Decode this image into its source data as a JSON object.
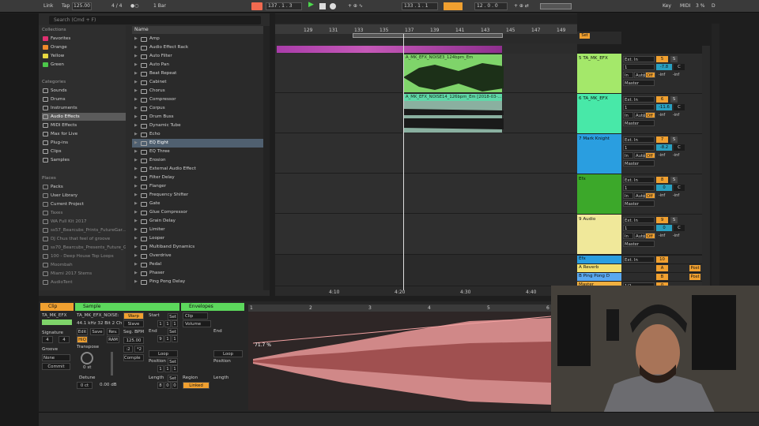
{
  "topbar": {
    "link": "Link",
    "tap": "Tap",
    "tempo": "125.00",
    "meter": "4 / 4",
    "quant": "1 Bar",
    "pos": "137 .  1 .  3",
    "loop_start": "133 .  1 .  1",
    "loop_len": "12 .  0 .  0",
    "key": "Key",
    "midi": "MIDI",
    "cpu": "3 %",
    "d": "D"
  },
  "browser": {
    "search_placeholder": "Search (Cmd + F)",
    "collections_label": "Collections",
    "collections": [
      {
        "label": "Favorites",
        "color": "#e03070"
      },
      {
        "label": "Orange",
        "color": "#f08a2a"
      },
      {
        "label": "Yellow",
        "color": "#e8d840"
      },
      {
        "label": "Green",
        "color": "#4cc84a"
      }
    ],
    "categories_label": "Categories",
    "categories": [
      "Sounds",
      "Drums",
      "Instruments",
      "Audio Effects",
      "MIDI Effects",
      "Max for Live",
      "Plug-ins",
      "Clips",
      "Samples"
    ],
    "selected_category": "Audio Effects",
    "places_label": "Places",
    "places": [
      "Packs",
      "User Library",
      "Current Project",
      "Taxes",
      "WA Full Kit 2017",
      "ss57_Bearcubs_Prints_FutureGar...",
      "DJ Chus that feel of groove",
      "ss70_Bearcubs_Presents_Future_G...",
      "100 - Deep House Top Loops",
      "Moombah",
      "Miami 2017 Stems",
      "AudioTent"
    ],
    "dim_places": [
      "Taxes",
      "WA Full Kit 2017",
      "ss57_Bearcubs_Prints_FutureGar...",
      "DJ Chus that feel of groove",
      "ss70_Bearcubs_Presents_Future_G...",
      "100 - Deep House Top Loops",
      "Moombah",
      "Miami 2017 Stems",
      "AudioTent"
    ],
    "name_header": "Name",
    "files": [
      "Amp",
      "Audio Effect Rack",
      "Auto Filter",
      "Auto Pan",
      "Beat Repeat",
      "Cabinet",
      "Chorus",
      "Compressor",
      "Corpus",
      "Drum Buss",
      "Dynamic Tube",
      "Echo",
      "EQ Eight",
      "EQ Three",
      "Erosion",
      "External Audio Effect",
      "Filter Delay",
      "Flanger",
      "Frequency Shifter",
      "Gate",
      "Glue Compressor",
      "Grain Delay",
      "Limiter",
      "Looper",
      "Multiband Dynamics",
      "Overdrive",
      "Pedal",
      "Phaser",
      "Ping Pong Delay"
    ],
    "selected_file": "EQ Eight"
  },
  "arrangement": {
    "bars": [
      "129",
      "131",
      "133",
      "135",
      "137",
      "139",
      "141",
      "143",
      "145",
      "147",
      "149"
    ],
    "times": [
      "4:10",
      "4:20",
      "4:30",
      "4:40"
    ],
    "clips": [
      {
        "name": "A_MK_EFX_NOISE3_124bpm_Em",
        "color": "#7fd46a"
      },
      {
        "name": "A_MK_EFX_NOISE14_126bpm_Em [2018-03-...",
        "color": "#5fd8a8"
      }
    ],
    "set_label": "Set"
  },
  "tracks": [
    {
      "name": "5 TA_MK_EFX",
      "color": "#a4e86a",
      "input": "Ext. In",
      "ch": "1",
      "num": "5",
      "vol": "-7.8",
      "pan": "C",
      "sends": [
        "-inf",
        "-inf"
      ],
      "mon": [
        "In",
        "Auto",
        "Off"
      ],
      "out": "Master"
    },
    {
      "name": "6 TA_MK_EFX",
      "color": "#48e8a8",
      "input": "Ext. In",
      "ch": "1",
      "num": "6",
      "vol": "-11.6",
      "pan": "C",
      "sends": [
        "-inf",
        "-inf"
      ],
      "mon": [
        "In",
        "Auto",
        "Off"
      ],
      "out": "Master"
    },
    {
      "name": "7 Mark Knight",
      "color": "#2a9ee0",
      "input": "Ext. In",
      "ch": "1",
      "num": "7",
      "vol": "-8.2",
      "pan": "C",
      "sends": [
        "-inf",
        "-inf"
      ],
      "mon": [
        "In",
        "Auto",
        "Off"
      ],
      "out": "Master"
    },
    {
      "name": "Efx",
      "color": "#3ca82a",
      "input": "Ext. In",
      "ch": "1",
      "num": "8",
      "vol": "0",
      "pan": "C",
      "sends": [
        "-inf",
        "-inf"
      ],
      "mon": [
        "In",
        "Auto",
        "Off"
      ],
      "out": "Master"
    },
    {
      "name": "9 Audio",
      "color": "#f0e89a",
      "input": "Ext. In",
      "ch": "1",
      "num": "9",
      "vol": "0",
      "pan": "C",
      "sends": [
        "-inf",
        "-inf"
      ],
      "mon": [
        "In",
        "Auto",
        "Off"
      ],
      "out": "Master"
    }
  ],
  "returns": [
    {
      "name": "Efx",
      "color": "#2a9ee0",
      "input": "Ext. In",
      "num": "10"
    },
    {
      "name": "A Reverb",
      "color": "#f0e070",
      "num": "A",
      "post": "Post"
    },
    {
      "name": "B Ping Pong D",
      "color": "#5aa8f0",
      "num": "B",
      "post": "Post"
    },
    {
      "name": "Master",
      "color": "#f0b040",
      "input": "1/2",
      "num": "0"
    }
  ],
  "clip_view": {
    "clip_header": "Clip",
    "clip_name": "TA_MK_EFX",
    "signature_label": "Signature",
    "sig_num": "4",
    "sig_den": "4",
    "groove_label": "Groove",
    "groove_val": "None",
    "commit": "Commit",
    "sample_header": "Sample",
    "sample_name": "TA_MK_EFX_NOISE:",
    "sample_info": "44.1 kHz 32 Bit 2 Ch",
    "warp": "Warp",
    "slave": "Slave",
    "edit": "Edit",
    "save": "Save",
    "rev": "Rev.",
    "hiq": "HiQ",
    "fade": "Fade",
    "ram": "RAM",
    "seg_bpm_label": "Seg. BPM",
    "seg_bpm": "125.00",
    "div2": ":2",
    "mul2": "*2",
    "transpose_label": "Transpose",
    "transpose_val": "0 st",
    "detune_label": "Detune",
    "detune_val": "0 ct",
    "gain_val": "0.00 dB",
    "complex": "Comple",
    "start_label": "Start",
    "end_label": "End",
    "loop_label": "Loop",
    "position_label": "Position",
    "length_label": "Length",
    "set": "Set",
    "start_vals": [
      "1",
      "1",
      "1"
    ],
    "end_vals": [
      "9",
      "1",
      "1"
    ],
    "pos_vals": [
      "1",
      "1",
      "1"
    ],
    "len_vals": [
      "8",
      "0",
      "0"
    ],
    "env_header": "Envelopes",
    "env_clip": "Clip",
    "env_volume": "Volume",
    "region_label": "Region",
    "linked": "Linked",
    "ruler": [
      "1",
      "2",
      "3",
      "4",
      "5",
      "6"
    ],
    "percent": "71.7 %"
  },
  "colors": {
    "accent": "#f0a030",
    "clip_green": "#7fd46a",
    "clip_teal": "#5fd8a8",
    "wave_red": "#d88a8a"
  }
}
